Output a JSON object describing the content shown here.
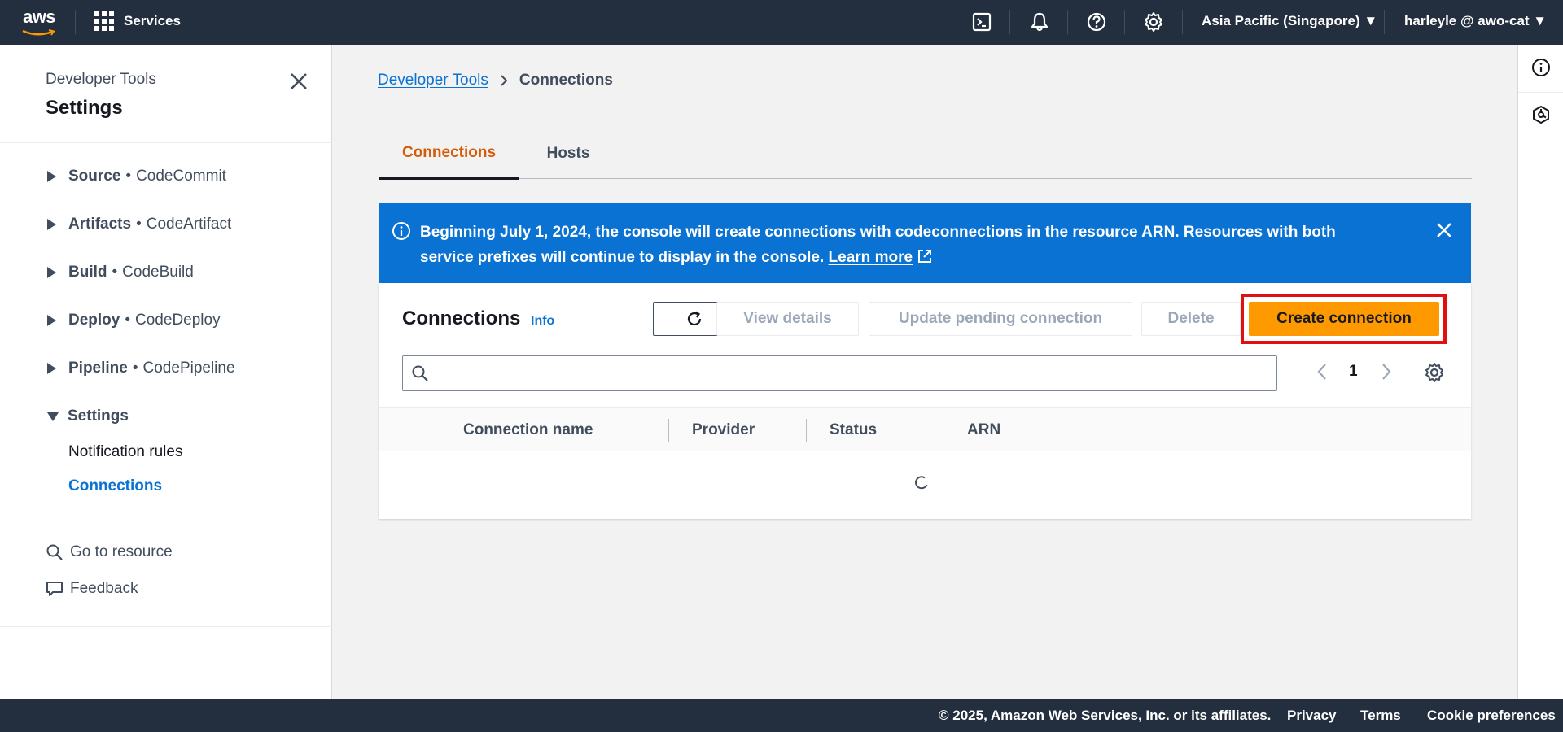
{
  "topnav": {
    "logo_text": "aws",
    "services_label": "Services",
    "region_label": "Asia Pacific (Singapore) ▼",
    "user_label": "harleyle @ awo-cat ▼",
    "icons": [
      "cloudshell-icon",
      "notifications-bell-icon",
      "help-icon",
      "settings-gear-icon"
    ]
  },
  "sidebar": {
    "section_title": "Developer Tools",
    "title": "Settings",
    "groups": [
      {
        "name": "Source",
        "service": "CodeCommit",
        "expanded": false
      },
      {
        "name": "Artifacts",
        "service": "CodeArtifact",
        "expanded": false
      },
      {
        "name": "Build",
        "service": "CodeBuild",
        "expanded": false
      },
      {
        "name": "Deploy",
        "service": "CodeDeploy",
        "expanded": false
      },
      {
        "name": "Pipeline",
        "service": "CodePipeline",
        "expanded": false
      },
      {
        "name": "Settings",
        "service": "",
        "expanded": true
      }
    ],
    "separator": "•",
    "sub_items": [
      {
        "label": "Notification rules",
        "active": false
      },
      {
        "label": "Connections",
        "active": true
      }
    ],
    "go_to_resource": "Go to resource",
    "feedback": "Feedback"
  },
  "breadcrumb": {
    "parent": "Developer Tools",
    "current": "Connections"
  },
  "tabs": [
    {
      "label": "Connections",
      "active": true
    },
    {
      "label": "Hosts",
      "active": false
    }
  ],
  "alert": {
    "message": "Beginning July 1, 2024, the console will create connections with codeconnections in the resource ARN. Resources with both service prefixes will continue to display in the console.",
    "link_label": "Learn more"
  },
  "connections_panel": {
    "title": "Connections",
    "info_label": "Info",
    "buttons": {
      "view_details": "View details",
      "update_pending": "Update pending connection",
      "delete": "Delete",
      "create": "Create connection"
    },
    "search_placeholder": "",
    "current_page": "1",
    "columns": [
      "Connection name",
      "Provider",
      "Status",
      "ARN"
    ],
    "loading": true
  },
  "footer": {
    "copyright": "© 2025, Amazon Web Services, Inc. or its affiliates.",
    "links": [
      "Privacy",
      "Terms",
      "Cookie preferences"
    ]
  },
  "colors": {
    "nav_bg": "#232f3e",
    "link_blue": "#0972d3",
    "tab_active": "#d45b07",
    "primary_button": "#ff9900",
    "alert_bg": "#0972d3",
    "highlight_box": "#e01010"
  }
}
